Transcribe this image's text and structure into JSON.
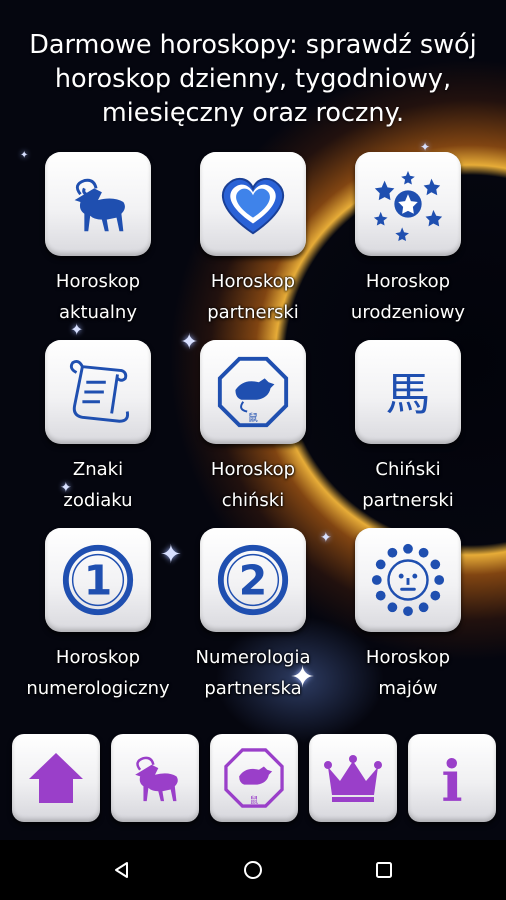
{
  "header": {
    "title_line1": "Darmowe horoskopy: sprawdź swój",
    "title_line2": "horoskop dzienny, tygodniowy,",
    "title_line3": "miesięczny oraz roczny."
  },
  "tiles": [
    {
      "icon": "ram-icon",
      "line1": "Horoskop",
      "line2": "aktualny"
    },
    {
      "icon": "heart-icon",
      "line1": "Horoskop",
      "line2": "partnerski"
    },
    {
      "icon": "stars-icon",
      "line1": "Horoskop",
      "line2": "urodzeniowy"
    },
    {
      "icon": "scroll-icon",
      "line1": "Znaki",
      "line2": "zodiaku"
    },
    {
      "icon": "rat-octagon-icon",
      "line1": "Horoskop",
      "line2": "chiński"
    },
    {
      "icon": "chinese-character-icon",
      "line1": "Chiński",
      "line2": "partnerski"
    },
    {
      "icon": "number-one-icon",
      "line1": "Horoskop",
      "line2": "numerologiczny"
    },
    {
      "icon": "number-two-icon",
      "line1": "Numerologia",
      "line2": "partnerska"
    },
    {
      "icon": "maya-sun-icon",
      "line1": "Horoskop",
      "line2": "majów"
    }
  ],
  "bottom_bar": [
    "home-icon",
    "ram-icon",
    "rat-octagon-icon",
    "crown-icon",
    "info-icon"
  ],
  "icon_glyphs": {
    "one": "1",
    "two": "2",
    "horse": "馬",
    "info": "i"
  },
  "colors": {
    "tile_icon_blue": "#1f4fb0",
    "bottom_icon_purple": "#9a3fc9",
    "text": "#ffffff"
  }
}
